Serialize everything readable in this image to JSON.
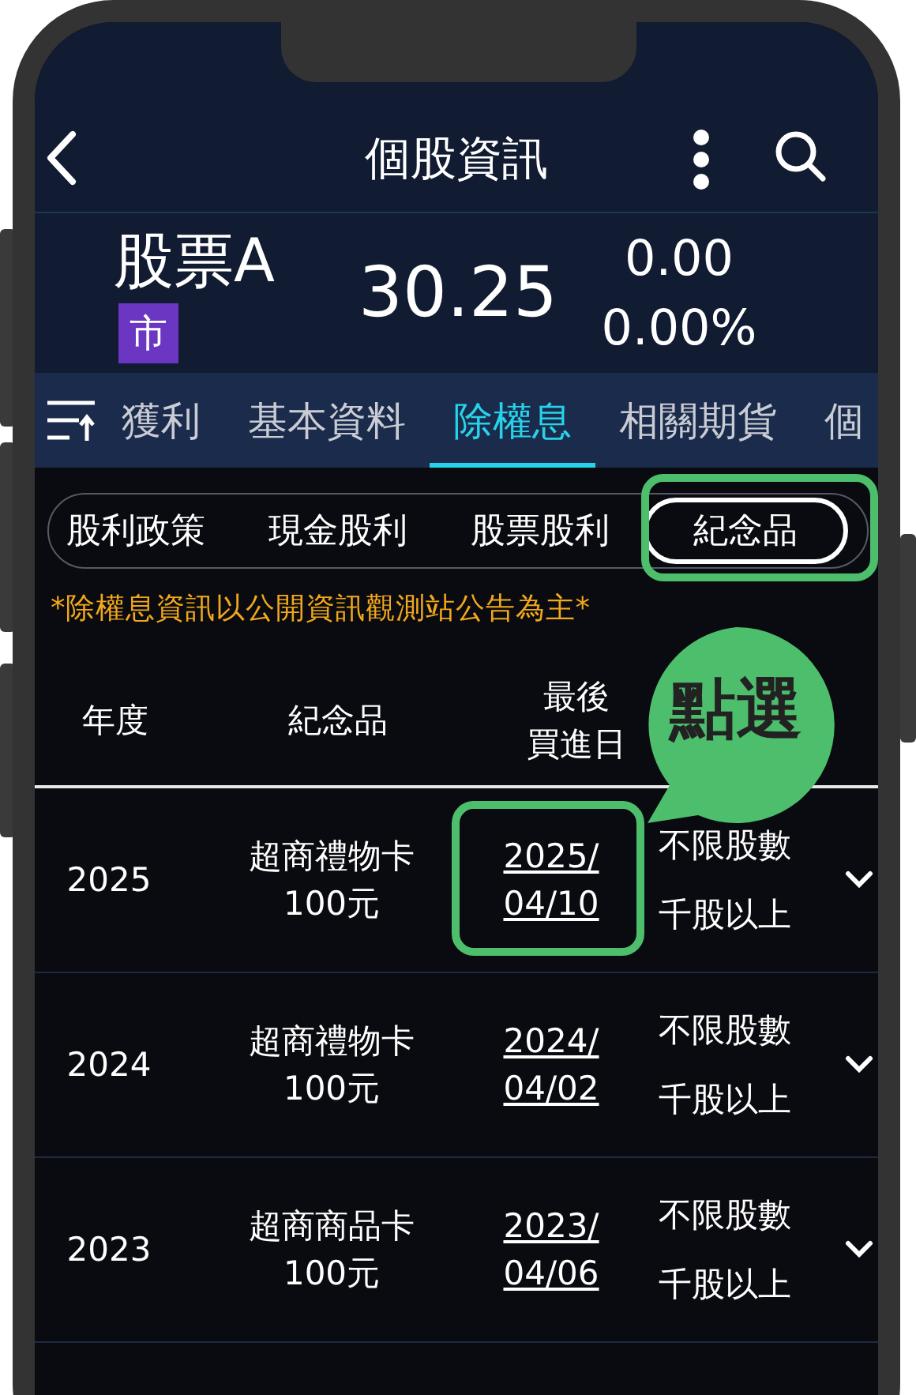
{
  "header": {
    "title": "個股資訊"
  },
  "stock": {
    "name": "股票A",
    "market_badge": "市",
    "price": "30.25",
    "change": "0.00",
    "change_percent": "0.00%"
  },
  "tabs": [
    {
      "label": "獲利",
      "selected": false
    },
    {
      "label": "基本資料",
      "selected": false
    },
    {
      "label": "除權息",
      "selected": true
    },
    {
      "label": "相關期貨",
      "selected": false
    },
    {
      "label": "個",
      "selected": false
    }
  ],
  "segments": [
    {
      "label": "股利政策",
      "selected": false
    },
    {
      "label": "現金股利",
      "selected": false
    },
    {
      "label": "股票股利",
      "selected": false
    },
    {
      "label": "紀念品",
      "selected": true
    }
  ],
  "notice": "*除權息資訊以公開資訊觀測站公告為主*",
  "table": {
    "columns": [
      "年度",
      "紀念品",
      [
        "最後",
        "買進日"
      ]
    ],
    "rows": [
      {
        "year": "2025",
        "gift": [
          "超商禮物卡",
          "100元"
        ],
        "last_buy_date": [
          "2025/",
          "04/10"
        ],
        "condition": [
          "不限股數",
          "千股以上"
        ]
      },
      {
        "year": "2024",
        "gift": [
          "超商禮物卡",
          "100元"
        ],
        "last_buy_date": [
          "2024/",
          "04/02"
        ],
        "condition": [
          "不限股數",
          "千股以上"
        ]
      },
      {
        "year": "2023",
        "gift": [
          "超商商品卡",
          "100元"
        ],
        "last_buy_date": [
          "2023/",
          "04/06"
        ],
        "condition": [
          "不限股數",
          "千股以上"
        ]
      }
    ]
  },
  "callout": {
    "text": "點選"
  }
}
